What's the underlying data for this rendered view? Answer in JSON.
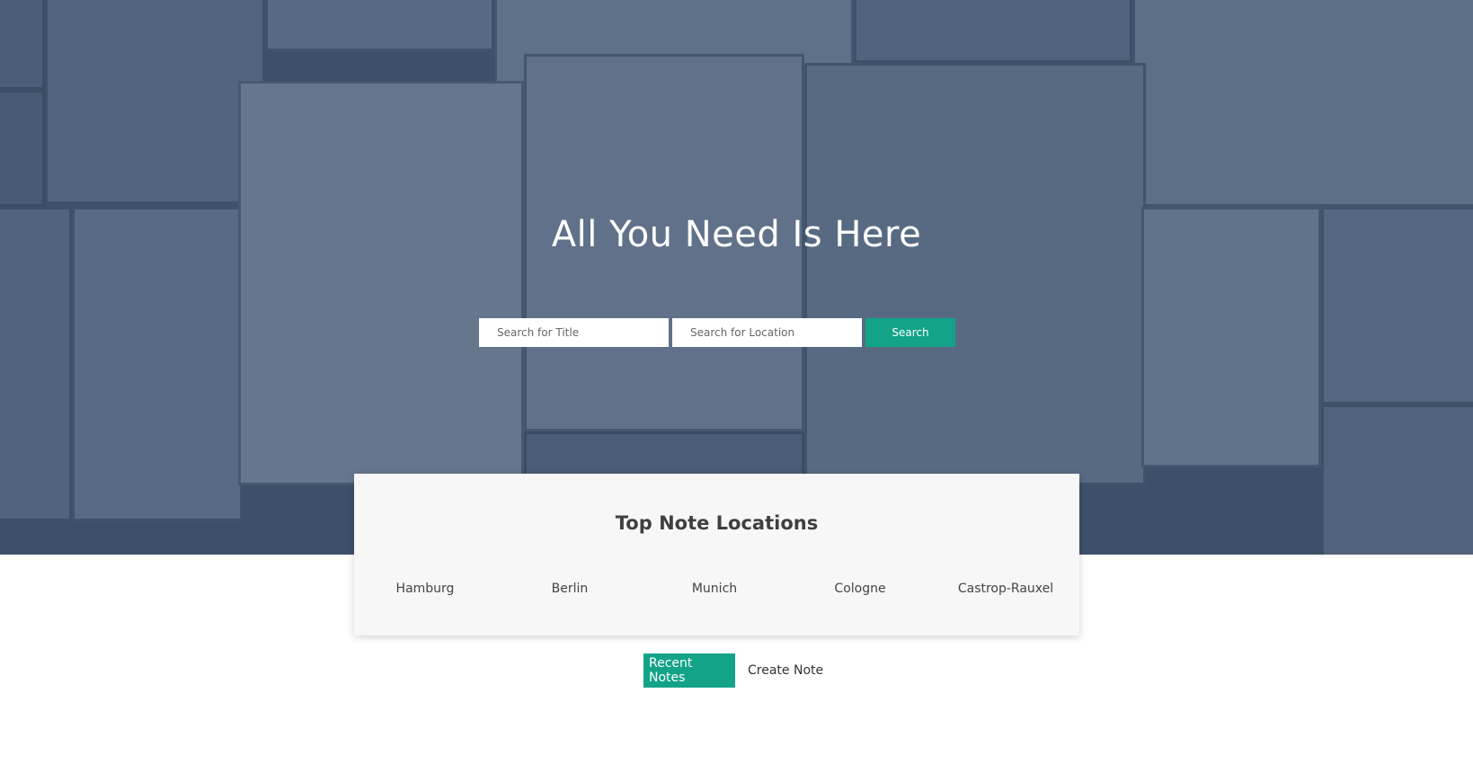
{
  "hero": {
    "title": "All You Need Is Here",
    "title_placeholder": "Search for Title",
    "location_placeholder": "Search for Location",
    "search_label": "Search"
  },
  "locations": {
    "title": "Top Note Locations",
    "items": [
      "Hamburg",
      "Berlin",
      "Munich",
      "Cologne",
      "Castrop-Rauxel"
    ]
  },
  "tabs": {
    "recent_label": "Recent Notes",
    "create_label": "Create Note"
  },
  "colors": {
    "accent": "#13a389",
    "hero_overlay": "#3f5169",
    "card_background": "#f7f7f7"
  }
}
